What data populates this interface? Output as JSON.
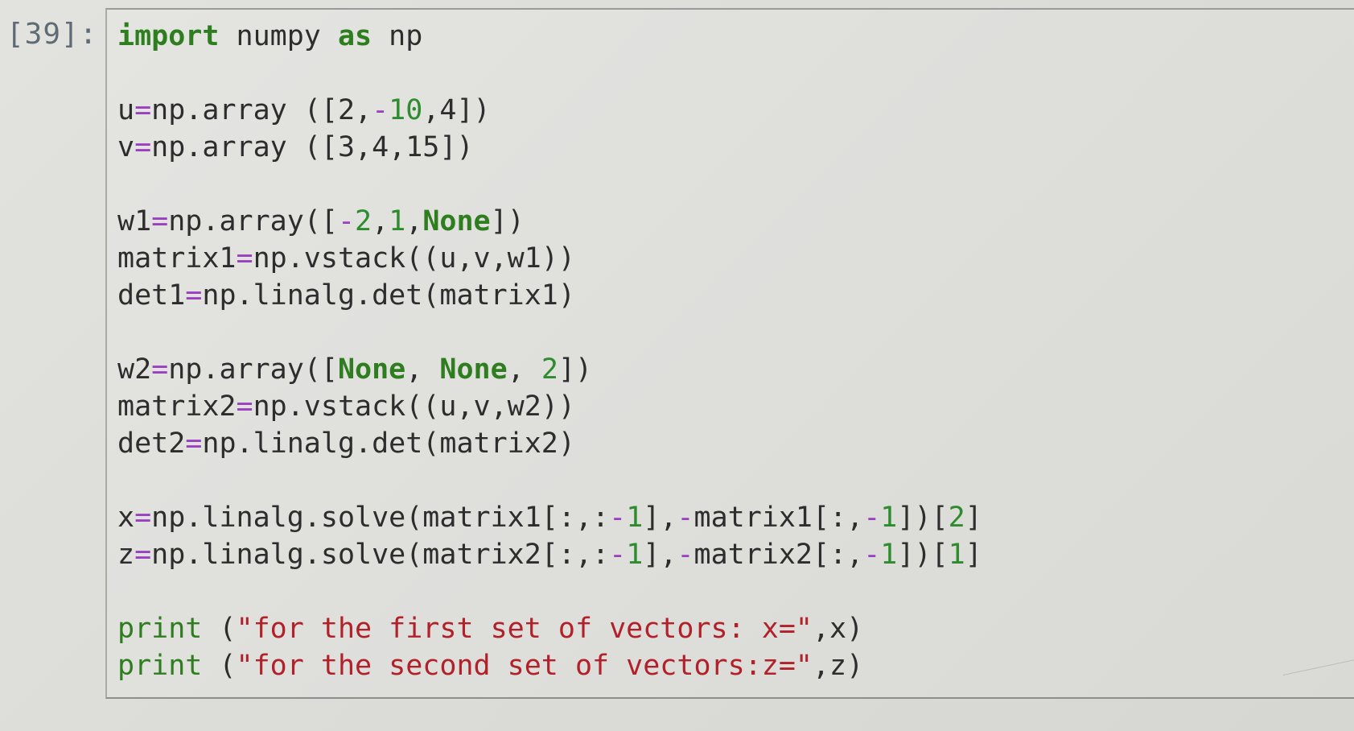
{
  "notebook": {
    "cell": {
      "prompt": "[39]:",
      "lines": [
        [
          {
            "t": "kw",
            "v": "import"
          },
          {
            "t": "nm",
            "v": " numpy "
          },
          {
            "t": "kw",
            "v": "as"
          },
          {
            "t": "nm",
            "v": " np"
          }
        ],
        [],
        [
          {
            "t": "nm",
            "v": "u"
          },
          {
            "t": "op",
            "v": "="
          },
          {
            "t": "nm",
            "v": "np.array ([2,"
          },
          {
            "t": "op",
            "v": "-"
          },
          {
            "t": "num",
            "v": "10"
          },
          {
            "t": "nm",
            "v": ",4])"
          }
        ],
        [
          {
            "t": "nm",
            "v": "v"
          },
          {
            "t": "op",
            "v": "="
          },
          {
            "t": "nm",
            "v": "np.array ([3,4,15])"
          }
        ],
        [],
        [
          {
            "t": "nm",
            "v": "w1"
          },
          {
            "t": "op",
            "v": "="
          },
          {
            "t": "nm",
            "v": "np.array(["
          },
          {
            "t": "op",
            "v": "-"
          },
          {
            "t": "num",
            "v": "2"
          },
          {
            "t": "nm",
            "v": ","
          },
          {
            "t": "num",
            "v": "1"
          },
          {
            "t": "nm",
            "v": ","
          },
          {
            "t": "kw",
            "v": "None"
          },
          {
            "t": "nm",
            "v": "])"
          }
        ],
        [
          {
            "t": "nm",
            "v": "matrix1"
          },
          {
            "t": "op",
            "v": "="
          },
          {
            "t": "nm",
            "v": "np.vstack((u,v,w1))"
          }
        ],
        [
          {
            "t": "nm",
            "v": "det1"
          },
          {
            "t": "op",
            "v": "="
          },
          {
            "t": "nm",
            "v": "np.linalg.det(matrix1)"
          }
        ],
        [],
        [
          {
            "t": "nm",
            "v": "w2"
          },
          {
            "t": "op",
            "v": "="
          },
          {
            "t": "nm",
            "v": "np.array(["
          },
          {
            "t": "kw",
            "v": "None"
          },
          {
            "t": "nm",
            "v": ", "
          },
          {
            "t": "kw",
            "v": "None"
          },
          {
            "t": "nm",
            "v": ", "
          },
          {
            "t": "num",
            "v": "2"
          },
          {
            "t": "nm",
            "v": "])"
          }
        ],
        [
          {
            "t": "nm",
            "v": "matrix2"
          },
          {
            "t": "op",
            "v": "="
          },
          {
            "t": "nm",
            "v": "np.vstack((u,v,w2))"
          }
        ],
        [
          {
            "t": "nm",
            "v": "det2"
          },
          {
            "t": "op",
            "v": "="
          },
          {
            "t": "nm",
            "v": "np.linalg.det(matrix2)"
          }
        ],
        [],
        [
          {
            "t": "nm",
            "v": "x"
          },
          {
            "t": "op",
            "v": "="
          },
          {
            "t": "nm",
            "v": "np.linalg.solve(matrix1[:,:"
          },
          {
            "t": "op",
            "v": "-"
          },
          {
            "t": "num",
            "v": "1"
          },
          {
            "t": "nm",
            "v": "],"
          },
          {
            "t": "op",
            "v": "-"
          },
          {
            "t": "nm",
            "v": "matrix1[:,"
          },
          {
            "t": "op",
            "v": "-"
          },
          {
            "t": "num",
            "v": "1"
          },
          {
            "t": "nm",
            "v": "])["
          },
          {
            "t": "num",
            "v": "2"
          },
          {
            "t": "nm",
            "v": "]"
          }
        ],
        [
          {
            "t": "nm",
            "v": "z"
          },
          {
            "t": "op",
            "v": "="
          },
          {
            "t": "nm",
            "v": "np.linalg.solve(matrix2[:,:"
          },
          {
            "t": "op",
            "v": "-"
          },
          {
            "t": "num",
            "v": "1"
          },
          {
            "t": "nm",
            "v": "],"
          },
          {
            "t": "op",
            "v": "-"
          },
          {
            "t": "nm",
            "v": "matrix2[:,"
          },
          {
            "t": "op",
            "v": "-"
          },
          {
            "t": "num",
            "v": "1"
          },
          {
            "t": "nm",
            "v": "])["
          },
          {
            "t": "num",
            "v": "1"
          },
          {
            "t": "nm",
            "v": "]"
          }
        ],
        [],
        [
          {
            "t": "bi",
            "v": "print"
          },
          {
            "t": "nm",
            "v": " ("
          },
          {
            "t": "str",
            "v": "\"for the first set of vectors: x=\""
          },
          {
            "t": "nm",
            "v": ",x)"
          }
        ],
        [
          {
            "t": "bi",
            "v": "print"
          },
          {
            "t": "nm",
            "v": " ("
          },
          {
            "t": "str",
            "v": "\"for the second set of vectors:z=\""
          },
          {
            "t": "nm",
            "v": ",z)"
          }
        ]
      ]
    }
  },
  "colors": {
    "keyword": "#2e7d1f",
    "operator": "#9a3fc0",
    "number": "#2e8b2e",
    "string": "#b2202a",
    "text": "#2d2d2d",
    "prompt": "#5f6b74"
  }
}
